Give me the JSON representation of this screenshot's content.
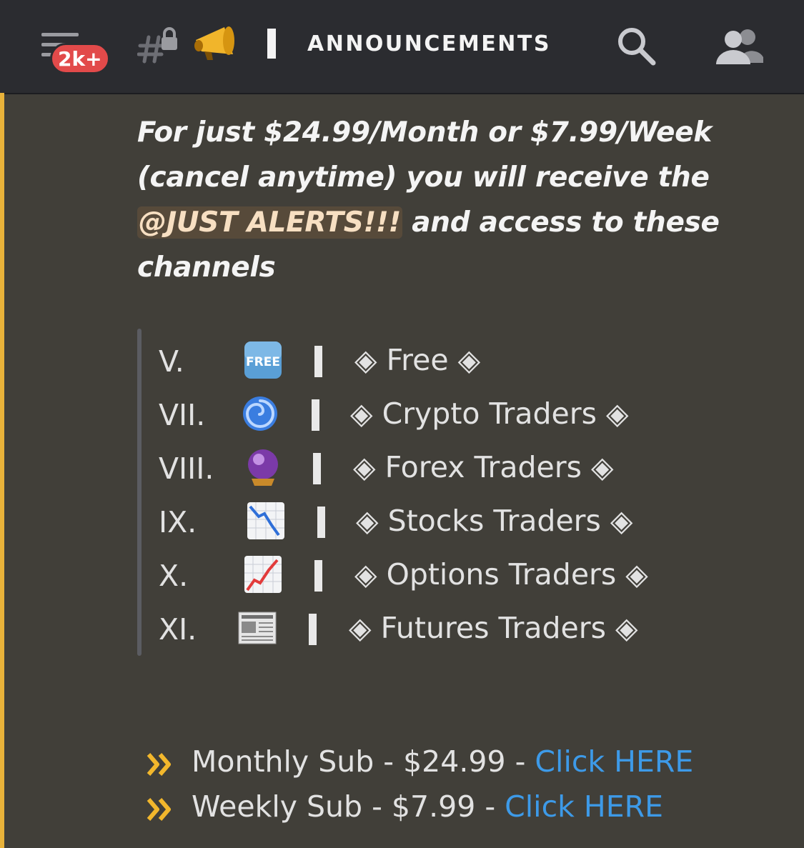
{
  "header": {
    "badge": "2k+",
    "channel_title": "ANNOUNCEMENTS",
    "icons": [
      "menu-icon",
      "locked-channel-icon",
      "megaphone-icon",
      "search-icon",
      "members-icon"
    ]
  },
  "message": {
    "line1": "For just $24.99/Month or $7.99/Week",
    "line2": "(cancel anytime) you will receive the",
    "mention": "@JUST ALERTS!!!",
    "line3_rest": " and access to these",
    "line4": "channels"
  },
  "channels": [
    {
      "num": "V.",
      "icon": "free-button-icon",
      "label": "◈ Free ◈"
    },
    {
      "num": "VII.",
      "icon": "cyclone-icon",
      "label": "◈ Crypto Traders ◈"
    },
    {
      "num": "VIII.",
      "icon": "crystal-ball-icon",
      "label": "◈ Forex Traders ◈"
    },
    {
      "num": "IX.",
      "icon": "chart-decreasing-icon",
      "label": "◈ Stocks  Traders ◈"
    },
    {
      "num": "X.",
      "icon": "chart-increasing-icon",
      "label": "◈ Options Traders ◈"
    },
    {
      "num": "XI.",
      "icon": "newspaper-icon",
      "label": "◈ Futures  Traders ◈"
    }
  ],
  "subscriptions": [
    {
      "text": "Monthly Sub - $24.99  - ",
      "link": "Click HERE"
    },
    {
      "text": "Weekly Sub - $7.99  -  ",
      "link": "Click HERE"
    }
  ],
  "colors": {
    "background": "#413f39",
    "header": "#2b2c30",
    "accent": "#e8b23a",
    "badge": "#e24a4a",
    "link": "#3d9ae8",
    "mention_bg": "#574a3a"
  }
}
